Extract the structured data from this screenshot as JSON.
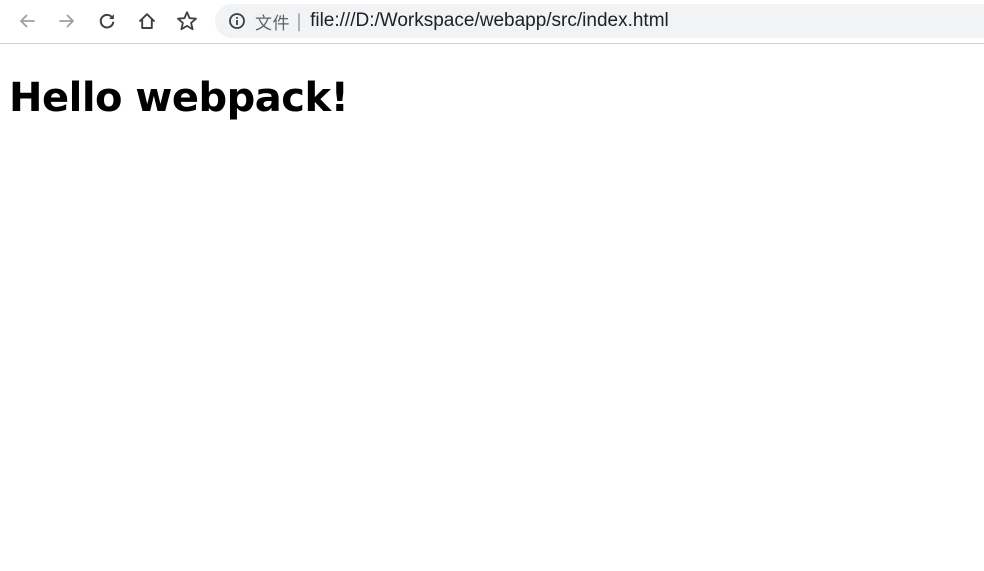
{
  "browser": {
    "toolbar": {
      "back_icon": "arrow-left",
      "forward_icon": "arrow-right",
      "reload_icon": "reload",
      "home_icon": "home",
      "bookmark_icon": "star-outline"
    },
    "omnibox": {
      "security_icon": "info-circle",
      "scheme_label": "文件",
      "separator": "|",
      "url": "file:///D:/Workspace/webapp/src/index.html"
    },
    "colors": {
      "icon_enabled": "#3c4043",
      "icon_disabled": "#9aa0a6",
      "omnibox_bg": "#f1f3f4"
    }
  },
  "page": {
    "heading": "Hello webpack!"
  }
}
